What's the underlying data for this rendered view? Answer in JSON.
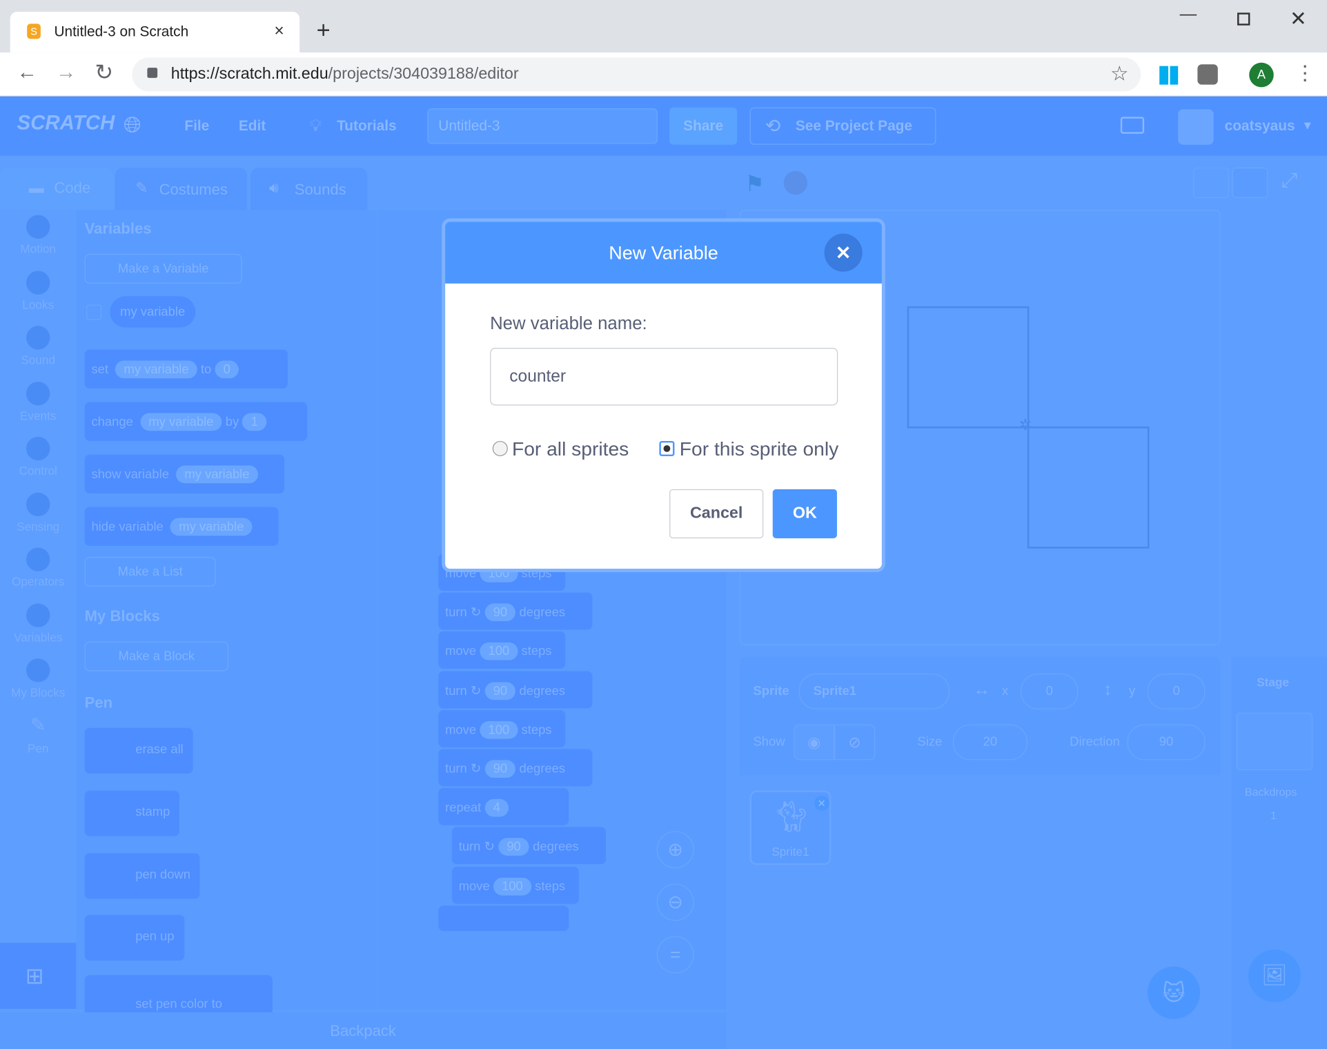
{
  "browser": {
    "tab_title": "Untitled-3 on Scratch",
    "url_host": "https://scratch.mit.edu",
    "url_path": "/projects/304039188/editor",
    "profile_initial": "A"
  },
  "menu": {
    "file": "File",
    "edit": "Edit",
    "tutorials": "Tutorials",
    "project_title": "Untitled-3",
    "share": "Share",
    "see_project_page": "See Project Page",
    "username": "coatsyaus",
    "logo": "SCRATCH"
  },
  "editor_tabs": {
    "code": "Code",
    "costumes": "Costumes",
    "sounds": "Sounds"
  },
  "categories": [
    "Motion",
    "Looks",
    "Sound",
    "Events",
    "Control",
    "Sensing",
    "Operators",
    "Variables",
    "My Blocks",
    "Pen"
  ],
  "palette": {
    "variables_heading": "Variables",
    "make_variable": "Make a Variable",
    "my_variable": "my variable",
    "set": "set",
    "to": "to",
    "set_value": "0",
    "change": "change",
    "by": "by",
    "change_value": "1",
    "show_variable": "show variable",
    "hide_variable": "hide variable",
    "make_list": "Make a List",
    "my_blocks_heading": "My Blocks",
    "make_block": "Make a Block",
    "pen_heading": "Pen",
    "erase_all": "erase all",
    "stamp": "stamp",
    "pen_down": "pen down",
    "pen_up": "pen up",
    "set_pen_color": "set pen color to"
  },
  "script": {
    "move": "move",
    "steps": "steps",
    "turn": "turn",
    "degrees": "degrees",
    "n100": "100",
    "n90": "90",
    "repeat": "repeat",
    "n4": "4"
  },
  "sprite_info": {
    "sprite_label": "Sprite",
    "sprite_name": "Sprite1",
    "x_label": "x",
    "x": "0",
    "y_label": "y",
    "y": "0",
    "show_label": "Show",
    "size_label": "Size",
    "size": "20",
    "direction_label": "Direction",
    "direction": "90",
    "stage_label": "Stage",
    "backdrops_label": "Backdrops",
    "backdrops_count": "1",
    "thumb_name": "Sprite1"
  },
  "backpack": "Backpack",
  "dialog": {
    "title": "New Variable",
    "prompt": "New variable name:",
    "input_value": "counter",
    "option_all": "For all sprites",
    "option_this": "For this sprite only",
    "selected_option": "For this sprite only",
    "cancel": "Cancel",
    "ok": "OK"
  }
}
